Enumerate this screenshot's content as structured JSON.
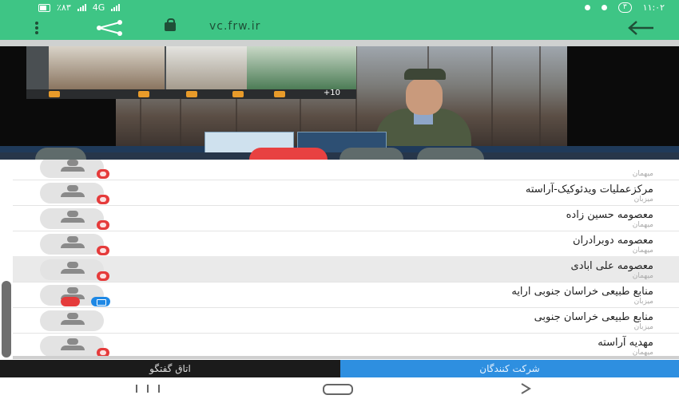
{
  "status_bar": {
    "left_text": "٪۸۳",
    "network": "4G",
    "notifications_badge": "۳",
    "time": "۱۱:۰۲"
  },
  "browser": {
    "url": "vc.frw.ir",
    "menu_icon": "more-vert-icon",
    "share_icon": "share-icon",
    "lock_icon": "lock-icon",
    "back_icon": "arrow-back-icon"
  },
  "video": {
    "more_participants": "+10",
    "colors": {
      "vest": "#4e5a41",
      "face": "#c99a7c"
    }
  },
  "participants": [
    {
      "name": "",
      "role": "میهمان",
      "mic": "off",
      "camera": "off"
    },
    {
      "name": "مرکزعملیات ویدئوکیک-آراسته",
      "role": "میزبان",
      "mic": "off",
      "camera": "off"
    },
    {
      "name": "معصومه حسین زاده",
      "role": "میهمان",
      "mic": "off",
      "camera": "off"
    },
    {
      "name": "معصومه دوبرادران",
      "role": "میهمان",
      "mic": "off",
      "camera": "off"
    },
    {
      "name": "معصومه علی ابادی",
      "role": "میهمان",
      "mic": "off",
      "camera": "off",
      "selected": true
    },
    {
      "name": "منابع طبیعی خراسان جنوبی ارایه",
      "role": "میزبان",
      "mic": "off",
      "camera": "on"
    },
    {
      "name": "منابع طبیعی خراسان جنوبی",
      "role": "میزبان",
      "mic": "none",
      "camera": "off"
    },
    {
      "name": "مهدیه آراسته",
      "role": "میهمان",
      "mic": "off",
      "camera": "off"
    }
  ],
  "tabs": {
    "chat_room": "اتاق گفتگو",
    "participants": "شرکت کنندگان"
  },
  "colors": {
    "accent": "#3ec585",
    "active_tab": "#2e8fe0",
    "mic_off": "#e53b3b",
    "camera_on": "#1e88e5"
  }
}
